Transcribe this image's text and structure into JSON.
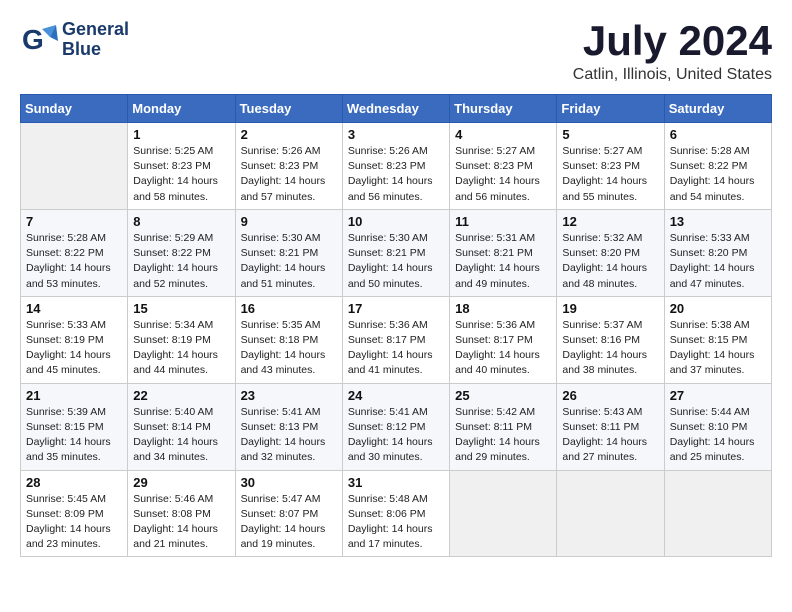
{
  "logo": {
    "line1": "General",
    "line2": "Blue"
  },
  "title": "July 2024",
  "location": "Catlin, Illinois, United States",
  "days_of_week": [
    "Sunday",
    "Monday",
    "Tuesday",
    "Wednesday",
    "Thursday",
    "Friday",
    "Saturday"
  ],
  "weeks": [
    [
      {
        "day": "",
        "info": ""
      },
      {
        "day": "1",
        "info": "Sunrise: 5:25 AM\nSunset: 8:23 PM\nDaylight: 14 hours\nand 58 minutes."
      },
      {
        "day": "2",
        "info": "Sunrise: 5:26 AM\nSunset: 8:23 PM\nDaylight: 14 hours\nand 57 minutes."
      },
      {
        "day": "3",
        "info": "Sunrise: 5:26 AM\nSunset: 8:23 PM\nDaylight: 14 hours\nand 56 minutes."
      },
      {
        "day": "4",
        "info": "Sunrise: 5:27 AM\nSunset: 8:23 PM\nDaylight: 14 hours\nand 56 minutes."
      },
      {
        "day": "5",
        "info": "Sunrise: 5:27 AM\nSunset: 8:23 PM\nDaylight: 14 hours\nand 55 minutes."
      },
      {
        "day": "6",
        "info": "Sunrise: 5:28 AM\nSunset: 8:22 PM\nDaylight: 14 hours\nand 54 minutes."
      }
    ],
    [
      {
        "day": "7",
        "info": "Sunrise: 5:28 AM\nSunset: 8:22 PM\nDaylight: 14 hours\nand 53 minutes."
      },
      {
        "day": "8",
        "info": "Sunrise: 5:29 AM\nSunset: 8:22 PM\nDaylight: 14 hours\nand 52 minutes."
      },
      {
        "day": "9",
        "info": "Sunrise: 5:30 AM\nSunset: 8:21 PM\nDaylight: 14 hours\nand 51 minutes."
      },
      {
        "day": "10",
        "info": "Sunrise: 5:30 AM\nSunset: 8:21 PM\nDaylight: 14 hours\nand 50 minutes."
      },
      {
        "day": "11",
        "info": "Sunrise: 5:31 AM\nSunset: 8:21 PM\nDaylight: 14 hours\nand 49 minutes."
      },
      {
        "day": "12",
        "info": "Sunrise: 5:32 AM\nSunset: 8:20 PM\nDaylight: 14 hours\nand 48 minutes."
      },
      {
        "day": "13",
        "info": "Sunrise: 5:33 AM\nSunset: 8:20 PM\nDaylight: 14 hours\nand 47 minutes."
      }
    ],
    [
      {
        "day": "14",
        "info": "Sunrise: 5:33 AM\nSunset: 8:19 PM\nDaylight: 14 hours\nand 45 minutes."
      },
      {
        "day": "15",
        "info": "Sunrise: 5:34 AM\nSunset: 8:19 PM\nDaylight: 14 hours\nand 44 minutes."
      },
      {
        "day": "16",
        "info": "Sunrise: 5:35 AM\nSunset: 8:18 PM\nDaylight: 14 hours\nand 43 minutes."
      },
      {
        "day": "17",
        "info": "Sunrise: 5:36 AM\nSunset: 8:17 PM\nDaylight: 14 hours\nand 41 minutes."
      },
      {
        "day": "18",
        "info": "Sunrise: 5:36 AM\nSunset: 8:17 PM\nDaylight: 14 hours\nand 40 minutes."
      },
      {
        "day": "19",
        "info": "Sunrise: 5:37 AM\nSunset: 8:16 PM\nDaylight: 14 hours\nand 38 minutes."
      },
      {
        "day": "20",
        "info": "Sunrise: 5:38 AM\nSunset: 8:15 PM\nDaylight: 14 hours\nand 37 minutes."
      }
    ],
    [
      {
        "day": "21",
        "info": "Sunrise: 5:39 AM\nSunset: 8:15 PM\nDaylight: 14 hours\nand 35 minutes."
      },
      {
        "day": "22",
        "info": "Sunrise: 5:40 AM\nSunset: 8:14 PM\nDaylight: 14 hours\nand 34 minutes."
      },
      {
        "day": "23",
        "info": "Sunrise: 5:41 AM\nSunset: 8:13 PM\nDaylight: 14 hours\nand 32 minutes."
      },
      {
        "day": "24",
        "info": "Sunrise: 5:41 AM\nSunset: 8:12 PM\nDaylight: 14 hours\nand 30 minutes."
      },
      {
        "day": "25",
        "info": "Sunrise: 5:42 AM\nSunset: 8:11 PM\nDaylight: 14 hours\nand 29 minutes."
      },
      {
        "day": "26",
        "info": "Sunrise: 5:43 AM\nSunset: 8:11 PM\nDaylight: 14 hours\nand 27 minutes."
      },
      {
        "day": "27",
        "info": "Sunrise: 5:44 AM\nSunset: 8:10 PM\nDaylight: 14 hours\nand 25 minutes."
      }
    ],
    [
      {
        "day": "28",
        "info": "Sunrise: 5:45 AM\nSunset: 8:09 PM\nDaylight: 14 hours\nand 23 minutes."
      },
      {
        "day": "29",
        "info": "Sunrise: 5:46 AM\nSunset: 8:08 PM\nDaylight: 14 hours\nand 21 minutes."
      },
      {
        "day": "30",
        "info": "Sunrise: 5:47 AM\nSunset: 8:07 PM\nDaylight: 14 hours\nand 19 minutes."
      },
      {
        "day": "31",
        "info": "Sunrise: 5:48 AM\nSunset: 8:06 PM\nDaylight: 14 hours\nand 17 minutes."
      },
      {
        "day": "",
        "info": ""
      },
      {
        "day": "",
        "info": ""
      },
      {
        "day": "",
        "info": ""
      }
    ]
  ]
}
